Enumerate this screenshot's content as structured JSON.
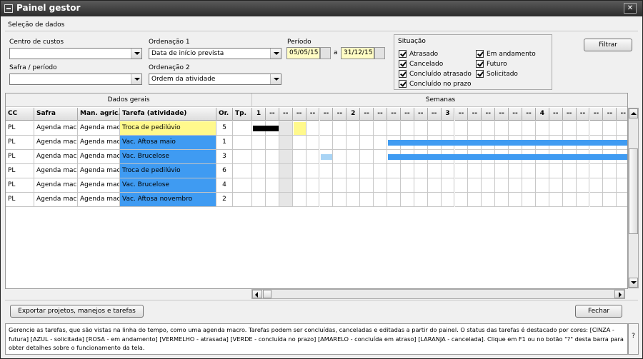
{
  "window": {
    "title": "Painel gestor",
    "close_glyph": "✕"
  },
  "section_label": "Seleção de dados",
  "filters": {
    "cost_center_label": "Centro de custos",
    "cost_center_value": "",
    "safra_label": "Safra / período",
    "safra_value": "",
    "order1_label": "Ordenação 1",
    "order1_value": "Data de início prevista",
    "order2_label": "Ordenação 2",
    "order2_value": "Ordem da atividade",
    "period_label": "Período",
    "period_start": "05/05/15",
    "period_sep": "a",
    "period_end": "31/12/15"
  },
  "situacao": {
    "title": "Situação",
    "options": [
      {
        "label": "Atrasado",
        "checked": true
      },
      {
        "label": "Cancelado",
        "checked": true
      },
      {
        "label": "Concluído atrasado",
        "checked": true
      },
      {
        "label": "Concluído no prazo",
        "checked": true
      },
      {
        "label": "Em andamento",
        "checked": true
      },
      {
        "label": "Futuro",
        "checked": true
      },
      {
        "label": "Solicitado",
        "checked": true
      }
    ]
  },
  "buttons": {
    "filter": "Filtrar",
    "export": "Exportar projetos, manejos e tarefas",
    "close": "Fechar"
  },
  "grid": {
    "group_general": "Dados gerais",
    "group_weeks": "Semanas",
    "columns": [
      "CC",
      "Safra",
      "Man. agric.",
      "Tarefa (atividade)",
      "Or.",
      "Tp."
    ],
    "weeks": [
      "1",
      "--",
      "--",
      "--",
      "--",
      "--",
      "--",
      "2",
      "--",
      "--",
      "--",
      "--",
      "--",
      "--",
      "3",
      "--",
      "--",
      "--",
      "--",
      "--",
      "--",
      "4",
      "--",
      "--",
      "--",
      "--",
      "--",
      "--"
    ],
    "rows": [
      {
        "cc": "PL",
        "safra": "Agenda macro",
        "manejo": "Agenda macro",
        "tarefa": "Troca de pedilúvio",
        "ordem": "5",
        "tipo": "",
        "task_color": "#fff98c"
      },
      {
        "cc": "PL",
        "safra": "Agenda macro",
        "manejo": "Agenda macro",
        "tarefa": "Vac. Aftosa maio",
        "ordem": "1",
        "tipo": "",
        "task_color": "#3f9bf2"
      },
      {
        "cc": "PL",
        "safra": "Agenda macro",
        "manejo": "Agenda macro",
        "tarefa": "Vac. Brucelose",
        "ordem": "3",
        "tipo": "",
        "task_color": "#3f9bf2"
      },
      {
        "cc": "PL",
        "safra": "Agenda macro",
        "manejo": "Agenda macro",
        "tarefa": "Troca de pedilúvio",
        "ordem": "6",
        "tipo": "",
        "task_color": "#3f9bf2"
      },
      {
        "cc": "PL",
        "safra": "Agenda macro",
        "manejo": "Agenda macro",
        "tarefa": "Vac. Brucelose",
        "ordem": "4",
        "tipo": "",
        "task_color": "#3f9bf2"
      },
      {
        "cc": "PL",
        "safra": "Agenda macro",
        "manejo": "Agenda macro",
        "tarefa": "Vac. Aftosa novembro",
        "ordem": "2",
        "tipo": "",
        "task_color": "#3f9bf2"
      }
    ],
    "timeline": [
      {
        "row": 0,
        "start": 0,
        "end": 1,
        "color": "#000000"
      },
      {
        "row": 0,
        "start": 3,
        "end": 3,
        "color": "#fff98c"
      },
      {
        "row": 1,
        "start": 10,
        "end": 27,
        "color": "#3f9bf2"
      },
      {
        "row": 2,
        "start": 5,
        "end": 5,
        "color": "#a9d4f5"
      },
      {
        "row": 2,
        "start": 10,
        "end": 27,
        "color": "#3f9bf2"
      }
    ],
    "today_week_index": 2
  },
  "help_text": "Gerencie as tarefas, que são vistas na linha do tempo, como uma agenda macro. Tarefas podem ser concluídas, canceladas e editadas a partir do painel. O status das tarefas é destacado por cores: [CINZA - futura] [AZUL - solicitada] [ROSA - em andamento] [VERMELHO - atrasada] [VERDE - concluída no prazo] [AMARELO - concluída em atraso] [LARANJA - cancelada]. Clique em F1 ou no botão \"?\" desta barra para obter detalhes sobre o funcionamento da tela.",
  "help_button": "?"
}
